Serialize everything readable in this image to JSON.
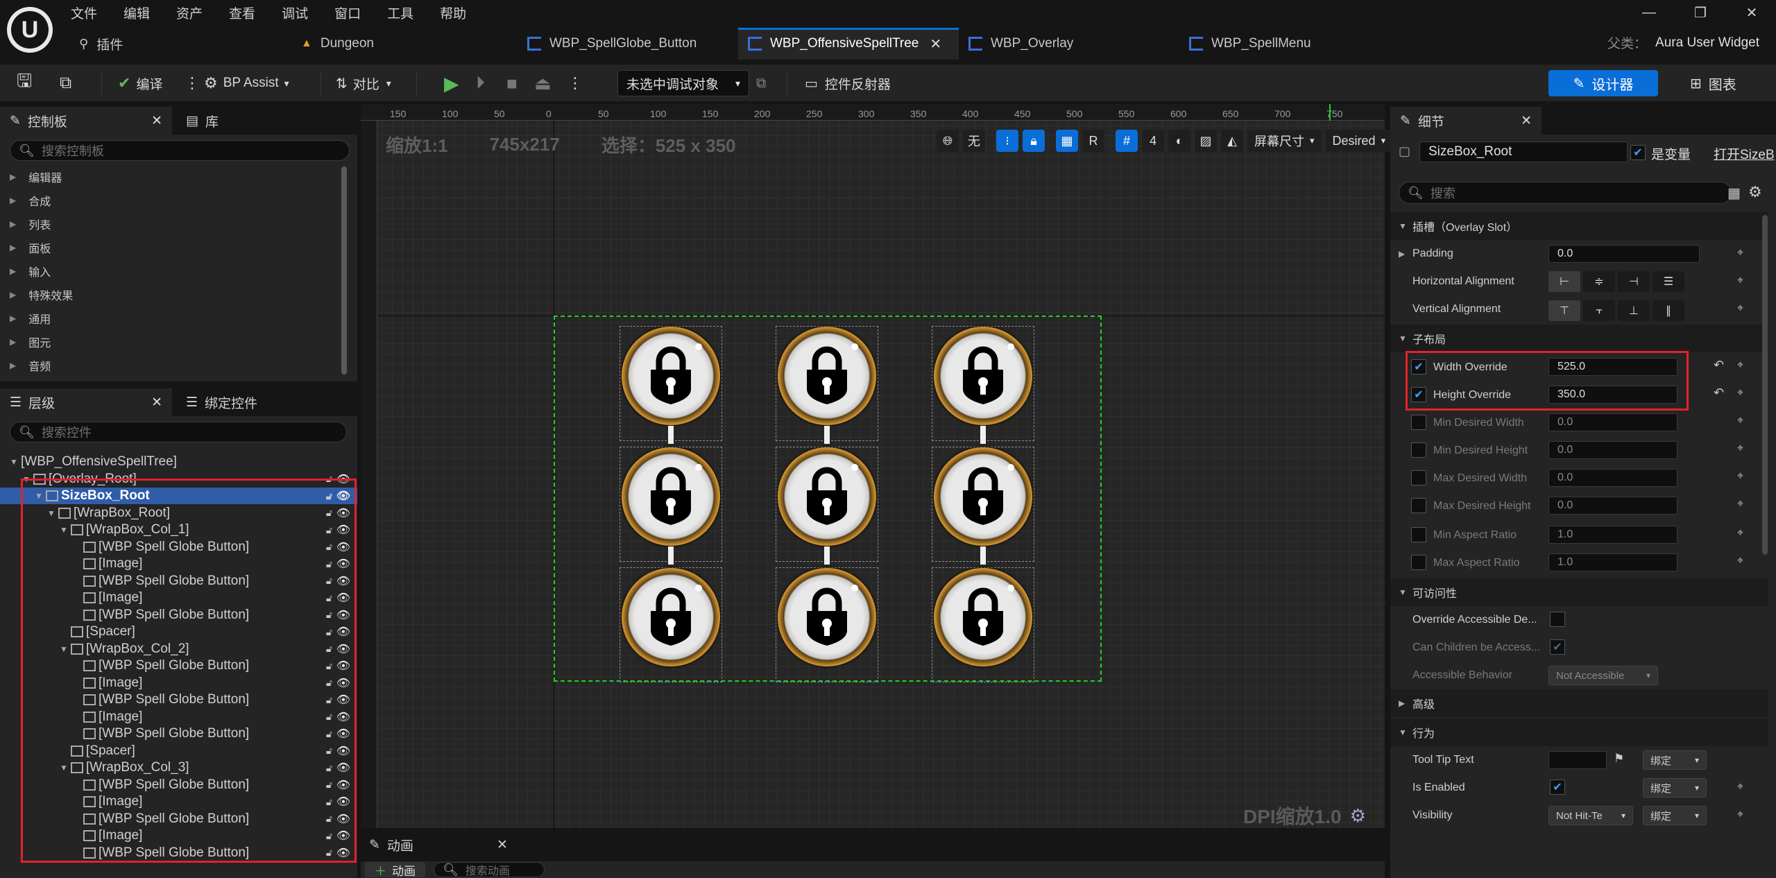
{
  "menu": [
    "文件",
    "编辑",
    "资产",
    "查看",
    "调试",
    "窗口",
    "工具",
    "帮助"
  ],
  "window_controls": [
    "—",
    "❐",
    "✕"
  ],
  "tabs": {
    "plugins": "插件",
    "dungeon": "Dungeon",
    "t1": "WBP_SpellGlobe_Button",
    "t2": "WBP_OffensiveSpellTree",
    "t3": "WBP_Overlay",
    "t4": "WBP_SpellMenu"
  },
  "parent": {
    "label": "父类：",
    "value": "Aura User Widget"
  },
  "toolbar": {
    "compile": "编译",
    "bp_assist": "BP Assist",
    "diff": "对比",
    "debug_target": "未选中调试对象",
    "widget_reflector": "控件反射器",
    "designer": "设计器",
    "graph": "图表"
  },
  "palette": {
    "tab": "控制板",
    "tab2": "库",
    "search_placeholder": "搜索控制板",
    "items": [
      "编辑器",
      "合成",
      "列表",
      "面板",
      "输入",
      "特殊效果",
      "通用",
      "图元",
      "音频"
    ]
  },
  "hierarchy": {
    "tab": "层级",
    "tab2": "绑定控件",
    "search_placeholder": "搜索控件",
    "rows": [
      {
        "label": "[WBP_OffensiveSpellTree]",
        "indent": 0
      },
      {
        "label": "[Overlay_Root]",
        "indent": 1
      },
      {
        "label": "SizeBox_Root",
        "indent": 2
      },
      {
        "label": "[WrapBox_Root]",
        "indent": 3
      },
      {
        "label": "[WrapBox_Col_1]",
        "indent": 4
      },
      {
        "label": "[WBP Spell Globe Button]",
        "indent": 5
      },
      {
        "label": "[Image]",
        "indent": 5
      },
      {
        "label": "[WBP Spell Globe Button]",
        "indent": 5
      },
      {
        "label": "[Image]",
        "indent": 5
      },
      {
        "label": "[WBP Spell Globe Button]",
        "indent": 5
      },
      {
        "label": "[Spacer]",
        "indent": 4
      },
      {
        "label": "[WrapBox_Col_2]",
        "indent": 4
      },
      {
        "label": "[WBP Spell Globe Button]",
        "indent": 5
      },
      {
        "label": "[Image]",
        "indent": 5
      },
      {
        "label": "[WBP Spell Globe Button]",
        "indent": 5
      },
      {
        "label": "[Image]",
        "indent": 5
      },
      {
        "label": "[WBP Spell Globe Button]",
        "indent": 5
      },
      {
        "label": "[Spacer]",
        "indent": 4
      },
      {
        "label": "[WrapBox_Col_3]",
        "indent": 4
      },
      {
        "label": "[WBP Spell Globe Button]",
        "indent": 5
      },
      {
        "label": "[Image]",
        "indent": 5
      },
      {
        "label": "[WBP Spell Globe Button]",
        "indent": 5
      },
      {
        "label": "[Image]",
        "indent": 5
      },
      {
        "label": "[WBP Spell Globe Button]",
        "indent": 5
      }
    ],
    "selected_index": 2
  },
  "viewport": {
    "zoom": "缩放1:1",
    "size": "745x217",
    "selection": "选择：525 x 350",
    "no_label": "无",
    "r_label": "R",
    "grid_num": "4",
    "screen_size": "屏幕尺寸",
    "desired": "Desired",
    "dpi": "DPI缩放1.0",
    "ruler_ticks": [
      "150",
      "100",
      "50",
      "0",
      "50",
      "100",
      "150",
      "200",
      "250",
      "300",
      "350",
      "400",
      "450",
      "500",
      "550",
      "600",
      "650",
      "700",
      "750"
    ],
    "globe_rows": 3,
    "globe_cols": 3
  },
  "animation": {
    "tab": "动画",
    "add": "动画",
    "search_placeholder": "搜索动画"
  },
  "details": {
    "tab": "细节",
    "name_value": "SizeBox_Root",
    "is_variable": "是变量",
    "open_sizebox": "打开SizeB",
    "search_placeholder": "搜索",
    "slot_section": "插槽（Overlay Slot）",
    "padding_label": "Padding",
    "padding_value": "0.0",
    "h_align": "Horizontal Alignment",
    "v_align": "Vertical Alignment",
    "child_layout": "子布局",
    "width_override": "Width Override",
    "width_value": "525.0",
    "height_override": "Height Override",
    "height_value": "350.0",
    "min_desired_width": "Min Desired Width",
    "min_desired_width_value": "0.0",
    "min_desired_height": "Min Desired Height",
    "min_desired_height_value": "0.0",
    "max_desired_width": "Max Desired Width",
    "max_desired_width_value": "0.0",
    "max_desired_height": "Max Desired Height",
    "max_desired_height_value": "0.0",
    "min_aspect": "Min Aspect Ratio",
    "min_aspect_value": "1.0",
    "max_aspect": "Max Aspect Ratio",
    "max_aspect_value": "1.0",
    "accessibility": "可访问性",
    "override_accessible": "Override Accessible De...",
    "can_children": "Can Children be Access...",
    "accessible_behavior": "Accessible Behavior",
    "accessible_behavior_value": "Not Accessible",
    "advanced": "高级",
    "behavior": "行为",
    "tooltip": "Tool Tip Text",
    "bind": "绑定",
    "is_enabled": "Is Enabled",
    "visibility": "Visibility",
    "visibility_value": "Not Hit-Te"
  }
}
